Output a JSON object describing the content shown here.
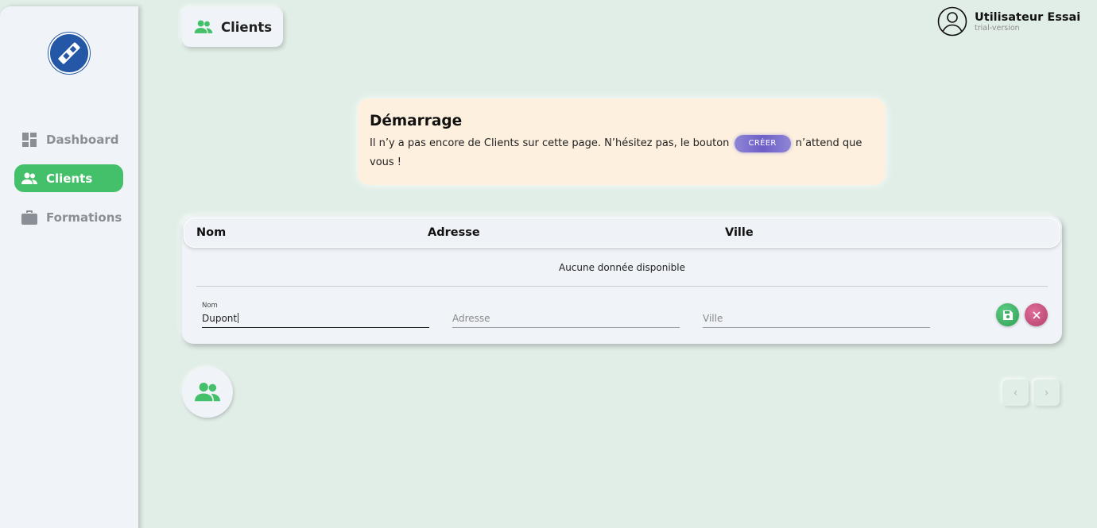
{
  "sidebar": {
    "items": [
      {
        "label": "Dashboard",
        "icon": "dashboard-icon",
        "active": false
      },
      {
        "label": "Clients",
        "icon": "people-icon",
        "active": true
      },
      {
        "label": "Formations",
        "icon": "briefcase-icon",
        "active": false
      }
    ]
  },
  "header": {
    "title": "Clients",
    "user_name": "Utilisateur Essai",
    "user_sub": "trial-version"
  },
  "info": {
    "title": "Démarrage",
    "text_before": "Il n’y a pas encore de Clients sur cette page. N’hésitez pas, le bouton",
    "button_label": "CRÉER",
    "text_after": "n’attend que vous !"
  },
  "table": {
    "columns": [
      "Nom",
      "Adresse",
      "Ville"
    ],
    "empty_text": "Aucune donnée disponible",
    "form": {
      "nom_label": "Nom",
      "nom_value": "Dupont",
      "adresse_placeholder": "Adresse",
      "ville_placeholder": "Ville"
    }
  },
  "pagination": {
    "prev": "‹",
    "next": "›"
  },
  "colors": {
    "accent": "#45c06a",
    "background": "#e1eee7",
    "info_bg": "#fdf0de",
    "cancel": "#c9497a"
  }
}
